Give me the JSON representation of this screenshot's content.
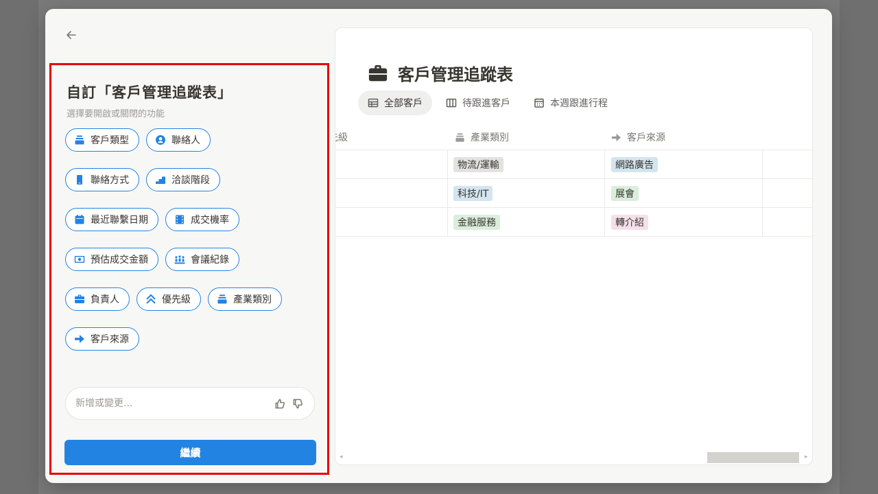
{
  "modal": {
    "back_icon": "arrow-left-icon"
  },
  "customize": {
    "title": "自訂「客戶管理追蹤表」",
    "subtitle": "選擇要開啟或關閉的功能",
    "chips": [
      {
        "label": "客戶類型",
        "icon": "stack-icon"
      },
      {
        "label": "聯絡人",
        "icon": "person-circle-icon"
      },
      {
        "label": "聯絡方式",
        "icon": "phone-icon"
      },
      {
        "label": "洽談階段",
        "icon": "stairs-icon"
      },
      {
        "label": "最近聯繫日期",
        "icon": "calendar-icon"
      },
      {
        "label": "成交機率",
        "icon": "film-icon"
      },
      {
        "label": "預估成交金額",
        "icon": "money-icon"
      },
      {
        "label": "會議紀錄",
        "icon": "people-icon"
      },
      {
        "label": "負責人",
        "icon": "briefcase-icon"
      },
      {
        "label": "優先級",
        "icon": "chevrons-up-icon"
      },
      {
        "label": "產業類別",
        "icon": "stack-icon"
      },
      {
        "label": "客戶來源",
        "icon": "arrow-right-icon"
      }
    ],
    "input_placeholder": "新增或變更...",
    "continue_label": "繼續"
  },
  "database": {
    "title": "客戶管理追蹤表",
    "title_icon": "briefcase-icon",
    "views": [
      {
        "label": "全部客戶",
        "icon": "table-icon",
        "active": true
      },
      {
        "label": "待跟進客戶",
        "icon": "board-icon",
        "active": false
      },
      {
        "label": "本週跟進行程",
        "icon": "calendar-icon",
        "active": false
      }
    ],
    "columns": [
      {
        "label": "先級",
        "icon": ""
      },
      {
        "label": "產業類別",
        "icon": "stack-icon"
      },
      {
        "label": "客戶來源",
        "icon": "arrow-right-icon"
      }
    ],
    "rows": [
      {
        "industry": "物流/運輸",
        "source": "網路廣告"
      },
      {
        "industry": "科技/IT",
        "source": "展會"
      },
      {
        "industry": "金融服務",
        "source": "轉介紹"
      }
    ],
    "colors": {
      "gray_tag": "#e3e2e0",
      "blue_tag": "#d3e5ef",
      "green_tag": "#dbeddb",
      "pink_tag": "#f5e0e9"
    }
  }
}
